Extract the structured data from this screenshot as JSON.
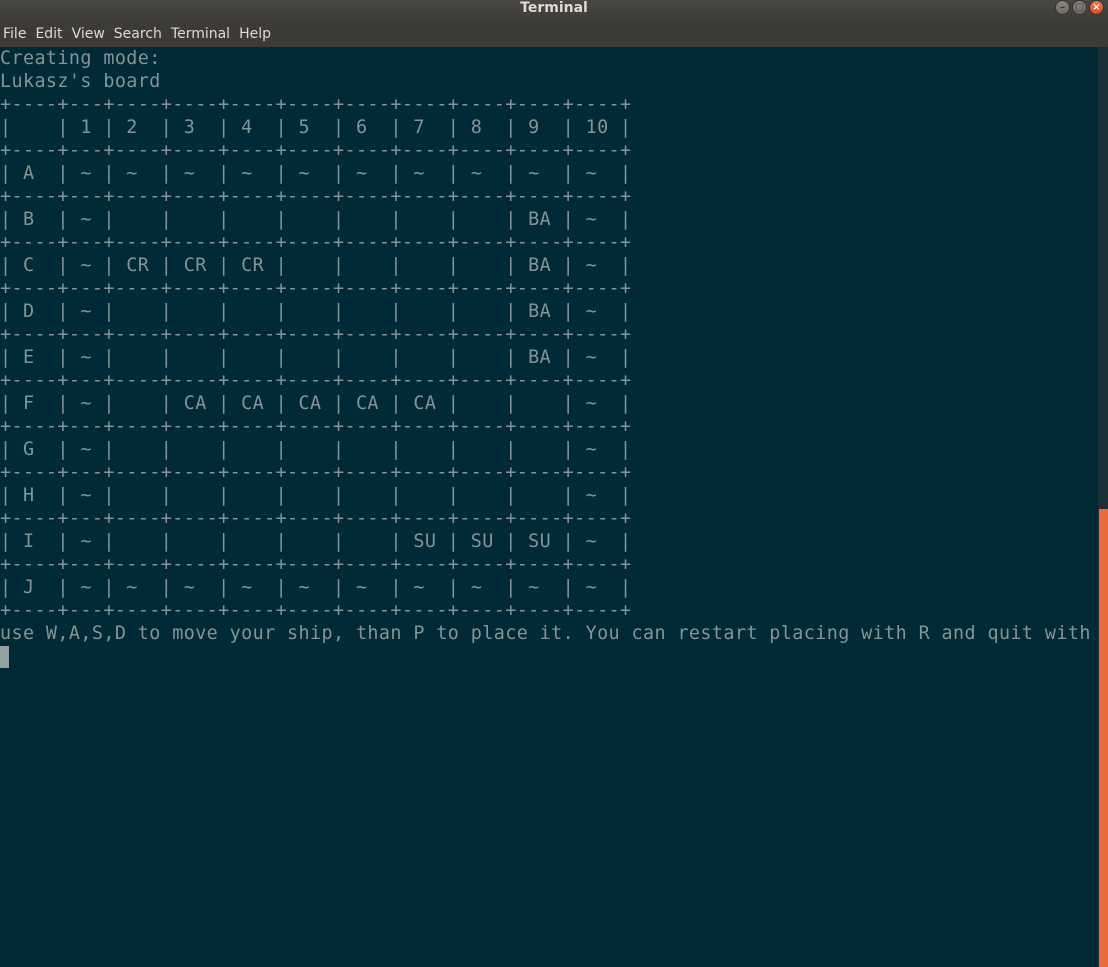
{
  "window": {
    "title": "Terminal",
    "controls": {
      "minimize": "–",
      "maximize": "□",
      "close": "×"
    }
  },
  "menu": [
    "File",
    "Edit",
    "View",
    "Search",
    "Terminal",
    "Help"
  ],
  "terminal": {
    "lines": [
      "Creating mode:",
      "Lukasz's board",
      "+----+---+----+----+----+----+----+----+----+----+----+",
      "|    | 1 | 2  | 3  | 4  | 5  | 6  | 7  | 8  | 9  | 10 |",
      "+----+---+----+----+----+----+----+----+----+----+----+",
      "| A  | ~ | ~  | ~  | ~  | ~  | ~  | ~  | ~  | ~  | ~  |",
      "+----+---+----+----+----+----+----+----+----+----+----+",
      "| B  | ~ |    |    |    |    |    |    |    | BA | ~  |",
      "+----+---+----+----+----+----+----+----+----+----+----+",
      "| C  | ~ | CR | CR | CR |    |    |    |    | BA | ~  |",
      "+----+---+----+----+----+----+----+----+----+----+----+",
      "| D  | ~ |    |    |    |    |    |    |    | BA | ~  |",
      "+----+---+----+----+----+----+----+----+----+----+----+",
      "| E  | ~ |    |    |    |    |    |    |    | BA | ~  |",
      "+----+---+----+----+----+----+----+----+----+----+----+",
      "| F  | ~ |    | CA | CA | CA | CA | CA |    |    | ~  |",
      "+----+---+----+----+----+----+----+----+----+----+----+",
      "| G  | ~ |    |    |    |    |    |    |    |    | ~  |",
      "+----+---+----+----+----+----+----+----+----+----+----+",
      "| H  | ~ |    |    |    |    |    |    |    |    | ~  |",
      "+----+---+----+----+----+----+----+----+----+----+----+",
      "| I  | ~ |    |    |    |    |    | SU | SU | SU | ~  |",
      "+----+---+----+----+----+----+----+----+----+----+----+",
      "| J  | ~ | ~  | ~  | ~  | ~  | ~  | ~  | ~  | ~  | ~  |",
      "+----+---+----+----+----+----+----+----+----+----+----+",
      "use W,A,S,D to move your ship, than P to place it. You can restart placing with R and quit with Q"
    ]
  },
  "colors": {
    "background": "#002b36",
    "foreground": "#839496",
    "scrollbar_thumb": "#e9693c"
  }
}
